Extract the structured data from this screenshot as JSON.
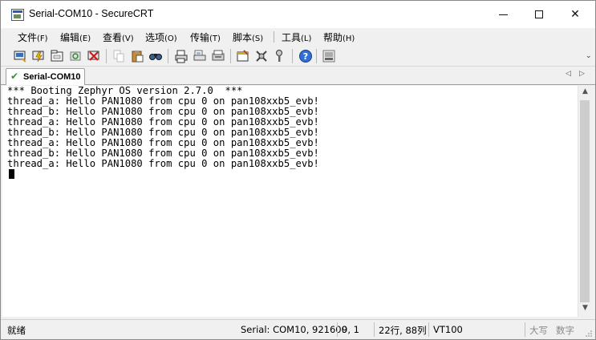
{
  "window": {
    "title": "Serial-COM10 - SecureCRT",
    "controls": [
      "minimize",
      "maximize",
      "close"
    ],
    "close_symbol": "✕"
  },
  "menu": [
    {
      "label": "文件",
      "hotkey": "(F)"
    },
    {
      "label": "编辑",
      "hotkey": "(E)"
    },
    {
      "label": "查看",
      "hotkey": "(V)"
    },
    {
      "label": "选项",
      "hotkey": "(O)"
    },
    {
      "label": "传输",
      "hotkey": "(T)"
    },
    {
      "label": "脚本",
      "hotkey": "(S)"
    },
    {
      "label": "工具",
      "hotkey": "(L)"
    },
    {
      "label": "帮助",
      "hotkey": "(H)"
    }
  ],
  "toolbar": {
    "icons": [
      "connect-icon",
      "quick-connect-icon",
      "connect-in-tab-icon",
      "reconnect-icon",
      "disconnect-icon",
      "copy-icon",
      "paste-icon",
      "find-icon",
      "print-icon",
      "print-selection-icon",
      "print-screen-icon",
      "session-options-icon",
      "global-options-icon",
      "keymap-icon",
      "help-icon",
      "sftp-icon"
    ],
    "overflow_symbol": "⌄"
  },
  "tab": {
    "label": "Serial-COM10",
    "status": "connected",
    "check_symbol": "✔",
    "scroll_left": "◁",
    "scroll_right": "▷"
  },
  "terminal": {
    "lines": [
      "*** Booting Zephyr OS version 2.7.0  ***",
      "thread_a: Hello PAN1080 from cpu 0 on pan108xxb5_evb!",
      "thread_b: Hello PAN1080 from cpu 0 on pan108xxb5_evb!",
      "thread_a: Hello PAN1080 from cpu 0 on pan108xxb5_evb!",
      "thread_b: Hello PAN1080 from cpu 0 on pan108xxb5_evb!",
      "thread_a: Hello PAN1080 from cpu 0 on pan108xxb5_evb!",
      "thread_b: Hello PAN1080 from cpu 0 on pan108xxb5_evb!",
      "thread_a: Hello PAN1080 from cpu 0 on pan108xxb5_evb!"
    ],
    "scroll_up": "▲",
    "scroll_down": "▼"
  },
  "status": {
    "ready": "就绪",
    "connection": "Serial: COM10, 921600",
    "cursor_pos": "9,  1",
    "size": "22行, 88列",
    "emulation": "VT100",
    "caps": "大写",
    "num": "数字"
  },
  "colors": {
    "window_bg": "#f0f0f0",
    "terminal_bg": "#ffffff",
    "terminal_fg": "#000000",
    "tab_check": "#2b9a2b"
  }
}
